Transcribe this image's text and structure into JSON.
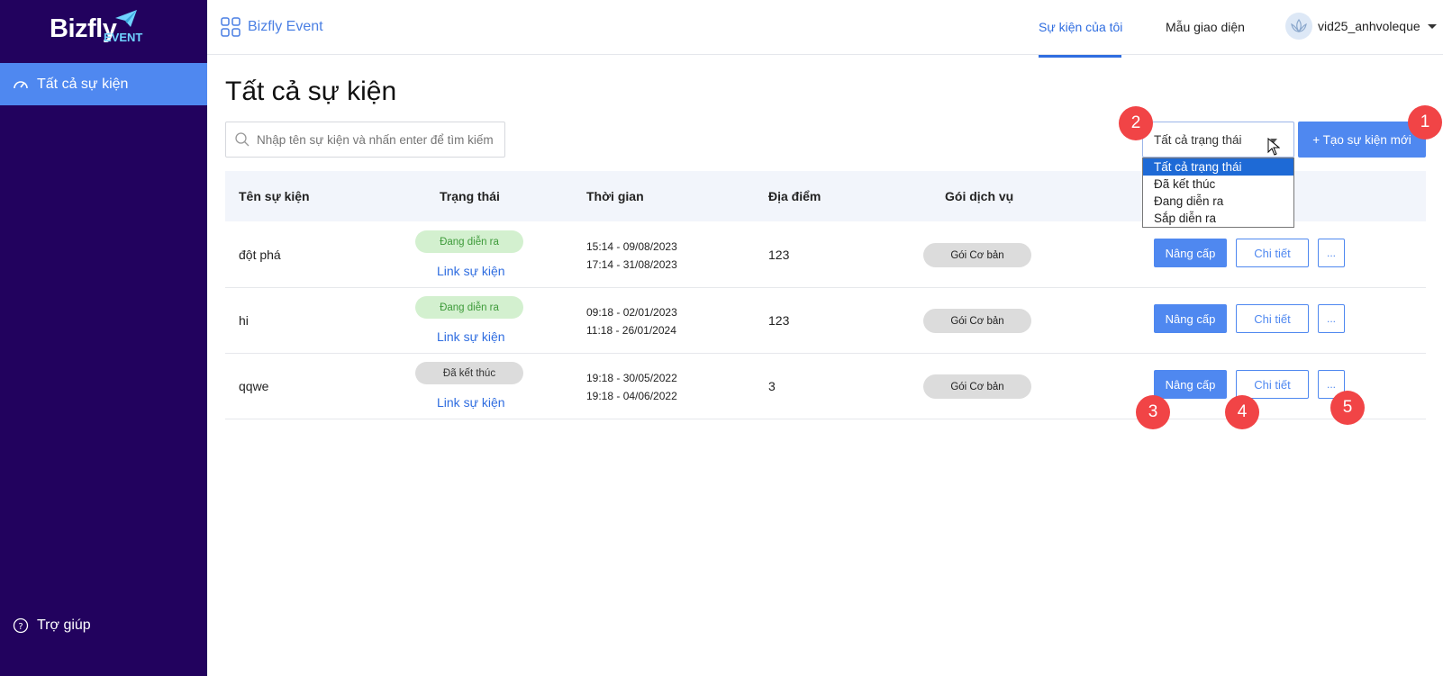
{
  "sidebar": {
    "logo_main": "Bizfly",
    "logo_sub": "EVENT",
    "active_item": "Tất cả sự kiện",
    "help": "Trợ giúp"
  },
  "header": {
    "brand": "Bizfly Event",
    "nav": [
      "Sự kiện của tôi",
      "Mẫu giao diện"
    ],
    "user": "vid25_anhvoleque"
  },
  "main": {
    "title": "Tất cả sự kiện",
    "search_placeholder": "Nhập tên sự kiện và nhấn enter để tìm kiếm",
    "status_value": "Tất cả trạng thái",
    "create_label": "+ Tạo sự kiện mới",
    "status_options": [
      "Tất cả trạng thái",
      "Đã kết thúc",
      "Đang diễn ra",
      "Sắp diễn ra"
    ]
  },
  "table": {
    "headers": [
      "Tên sự kiện",
      "Trạng thái",
      "Thời gian",
      "Địa điểm",
      "Gói dịch vụ"
    ],
    "rows": [
      {
        "name": "đột phá",
        "status": "Đang diễn ra",
        "link": "Link sự kiện",
        "start": "15:14 - 09/08/2023",
        "end": "17:14 - 31/08/2023",
        "location": "123",
        "package": "Gói Cơ bản"
      },
      {
        "name": "hi",
        "status": "Đang diễn ra",
        "link": "Link sự kiện",
        "start": "09:18 - 02/01/2023",
        "end": "11:18 - 26/01/2024",
        "location": "123",
        "package": "Gói Cơ bản"
      },
      {
        "name": "qqwe",
        "status": "Đã kết thúc",
        "link": "Link sự kiện",
        "start": "19:18 - 30/05/2022",
        "end": "19:18 - 04/06/2022",
        "location": "3",
        "package": "Gói Cơ bản"
      }
    ],
    "actions": {
      "upgrade": "Nâng cấp",
      "detail": "Chi tiết",
      "more": "..."
    }
  },
  "annotations": [
    "1",
    "2",
    "3",
    "4",
    "5"
  ],
  "colors": {
    "sidebar_bg": "#22025e",
    "accent": "#4f88f0",
    "marker": "#f14446"
  }
}
